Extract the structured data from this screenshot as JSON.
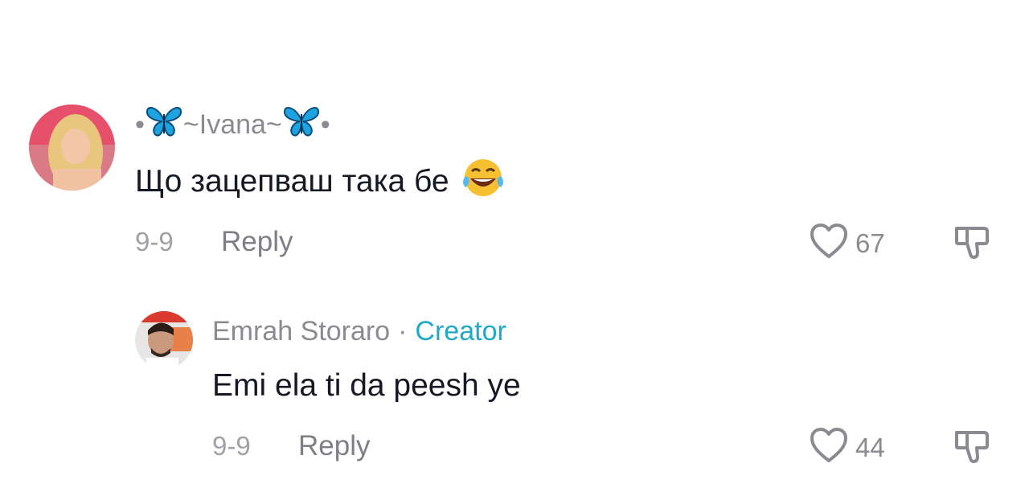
{
  "comments": [
    {
      "username_dot_left": "•",
      "username_core": "~Ivana~",
      "username_dot_right": "•",
      "text": "Що зацепваш така бе",
      "text_emoji": "😂",
      "date": "9-9",
      "reply_label": "Reply",
      "likes": "67"
    },
    {
      "username": "Emrah Storaro",
      "separator": "·",
      "creator_badge": "Creator",
      "text": "Emi ela ti da peesh ye",
      "date": "9-9",
      "reply_label": "Reply",
      "likes": "44"
    }
  ],
  "colors": {
    "creator_accent": "#20a8c8",
    "text_primary": "#161823",
    "text_secondary": "#8a8b91",
    "butterfly": "#1fa3e0"
  }
}
